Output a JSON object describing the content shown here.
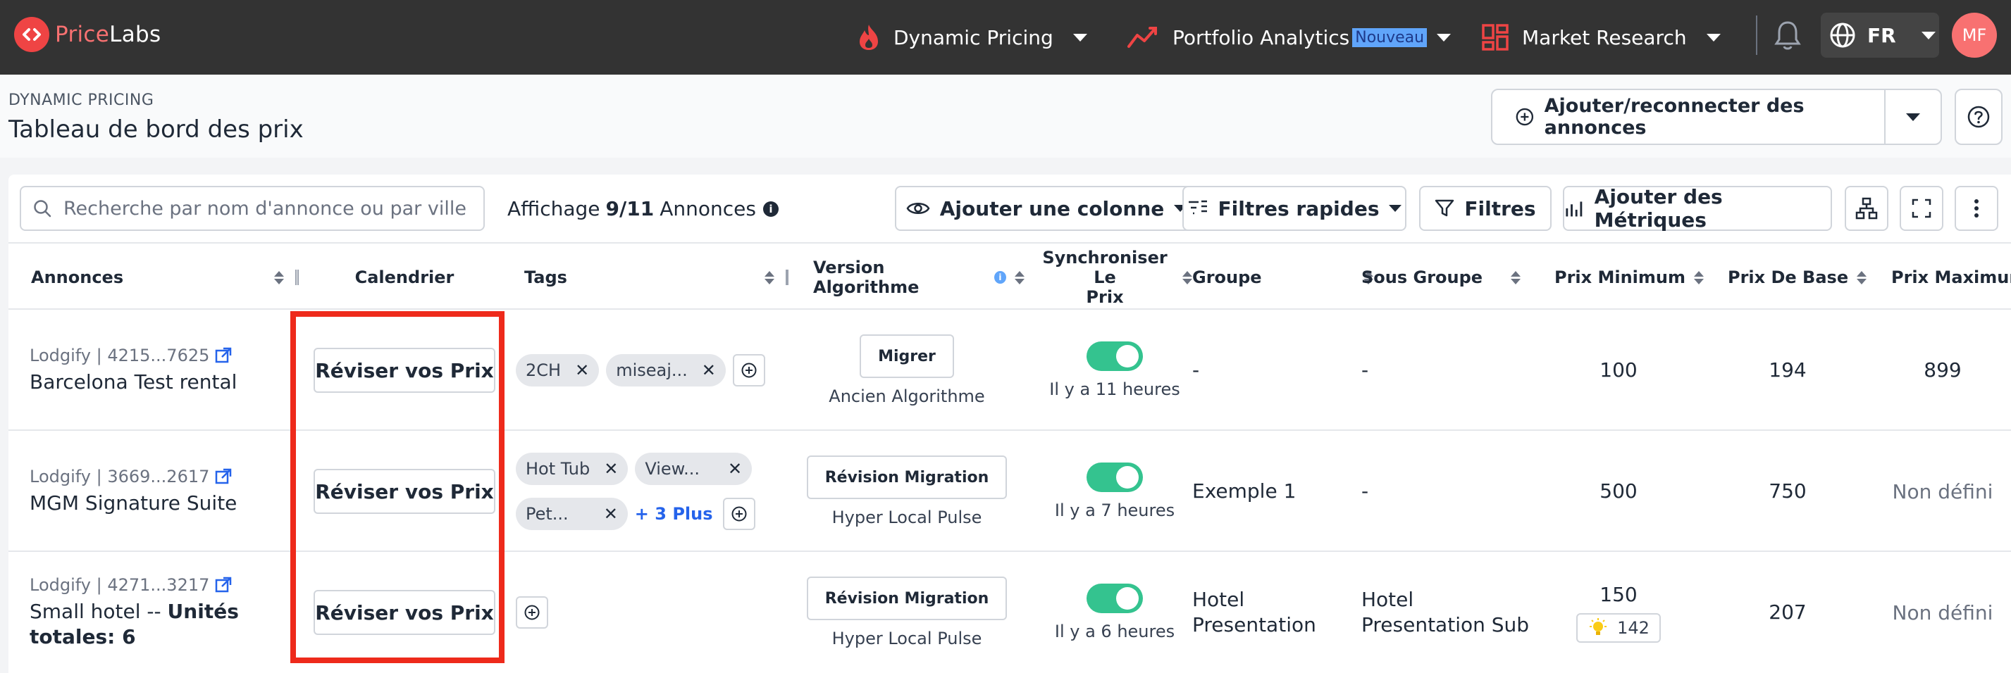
{
  "nav": {
    "brand_a": "Price",
    "brand_b": "Labs",
    "dynamic_pricing": "Dynamic Pricing",
    "portfolio": "Portfolio Analytics",
    "new_badge": "Nouveau",
    "market": "Market Research",
    "lang": "FR",
    "avatar": "MF",
    "colors": {
      "bar": "#333333",
      "accent": "#ef4444",
      "badge": "#60a5fa"
    }
  },
  "header": {
    "eyebrow": "DYNAMIC PRICING",
    "title": "Tableau de bord des prix",
    "add_label": "Ajouter/reconnecter des annonces"
  },
  "toolbar": {
    "search_placeholder": "Recherche par nom d'annonce ou par ville",
    "showing_prefix": "Affichage",
    "showing_count": "9/11",
    "showing_suffix": "Annonces",
    "add_column": "Ajouter une colonne",
    "quick_filters": "Filtres rapides",
    "filters": "Filtres",
    "add_metrics": "Ajouter des Métriques"
  },
  "columns": {
    "listings": "Annonces",
    "calendar": "Calendrier",
    "tags": "Tags",
    "algo": "Version Algorithme",
    "sync_1": "Synchroniser Le",
    "sync_2": "Prix",
    "group": "Groupe",
    "subgroup": "Sous Groupe",
    "min": "Prix Minimum",
    "base": "Prix De Base",
    "max": "Prix Maximum"
  },
  "rows": [
    {
      "channel": "Lodgify | 4215...7625",
      "name": "Barcelona Test rental",
      "review": "Réviser vos Prix",
      "tags": [
        "2CH",
        "miseaj..."
      ],
      "algo_btn": "Migrer",
      "algo_sub": "Ancien Algorithme",
      "sync_sub": "Il y a 11 heures",
      "group": "-",
      "subgroup": "-",
      "min": "100",
      "base": "194",
      "max": "899"
    },
    {
      "channel": "Lodgify | 3669...2617",
      "name": "MGM Signature Suite",
      "review": "Réviser vos Prix",
      "tags": [
        "Hot Tub",
        "View...",
        "Pet..."
      ],
      "more": "+ 3 Plus",
      "algo_btn": "Révision Migration",
      "algo_sub": "Hyper Local Pulse",
      "sync_sub": "Il y a 7 heures",
      "group": "Exemple 1",
      "subgroup": "-",
      "min": "500",
      "base": "750",
      "max": "Non défini"
    },
    {
      "channel": "Lodgify | 4271...3217",
      "name_a": "Small hotel -- ",
      "name_b": "Unités",
      "name_c": "totales: 6",
      "review": "Réviser vos Prix",
      "algo_btn": "Révision Migration",
      "algo_sub": "Hyper Local Pulse",
      "sync_sub": "Il y a 6 heures",
      "group_a": "Hotel",
      "group_b": "Presentation",
      "subgroup_a": "Hotel",
      "subgroup_b": "Presentation Sub",
      "min": "150",
      "min_hint": "142",
      "base": "207",
      "max": "Non défini"
    }
  ]
}
